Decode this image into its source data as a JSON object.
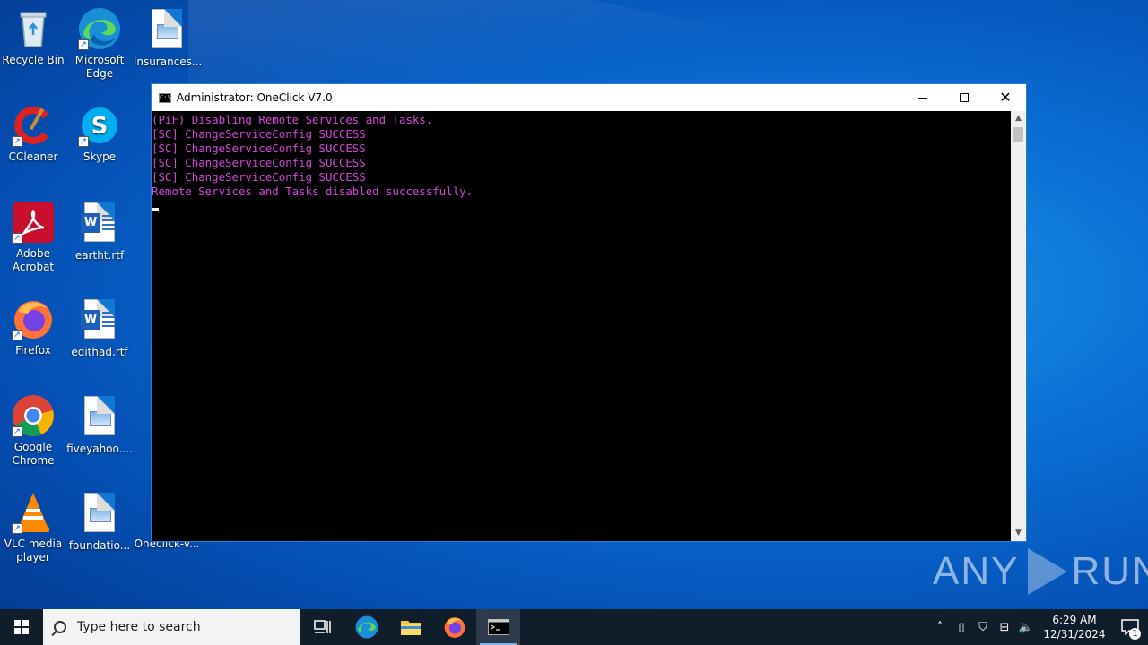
{
  "desktop": {
    "icons": {
      "recycle_bin": "Recycle Bin",
      "edge": "Microsoft Edge",
      "insurances": "insurances...",
      "ccleaner": "CCleaner",
      "skype": "Skype",
      "acrobat": "Adobe Acrobat",
      "eartht": "eartht.rtf",
      "firefox": "Firefox",
      "edithad": "edithad.rtf",
      "chrome": "Google Chrome",
      "fiveyahoo": "fiveyahoo....",
      "vlc": "VLC media player",
      "foundatio": "foundatio...",
      "oneclick": "Oneclick-v..."
    }
  },
  "window": {
    "title": "Administrator:  OneClick V7.0",
    "lines": [
      "(PiF) Disabling Remote Services and Tasks.",
      "[SC] ChangeServiceConfig SUCCESS",
      "[SC] ChangeServiceConfig SUCCESS",
      "[SC] ChangeServiceConfig SUCCESS",
      "[SC] ChangeServiceConfig SUCCESS",
      "Remote Services and Tasks disabled successfully."
    ]
  },
  "watermark": {
    "left": "ANY",
    "right": "RUN"
  },
  "taskbar": {
    "search_placeholder": "Type here to search",
    "time": "6:29 AM",
    "date": "12/31/2024",
    "notification_count": "1"
  },
  "colors": {
    "console_text": "#d14ad6",
    "taskbar_bg": "#101d2b",
    "accent": "#0a6fd4"
  }
}
